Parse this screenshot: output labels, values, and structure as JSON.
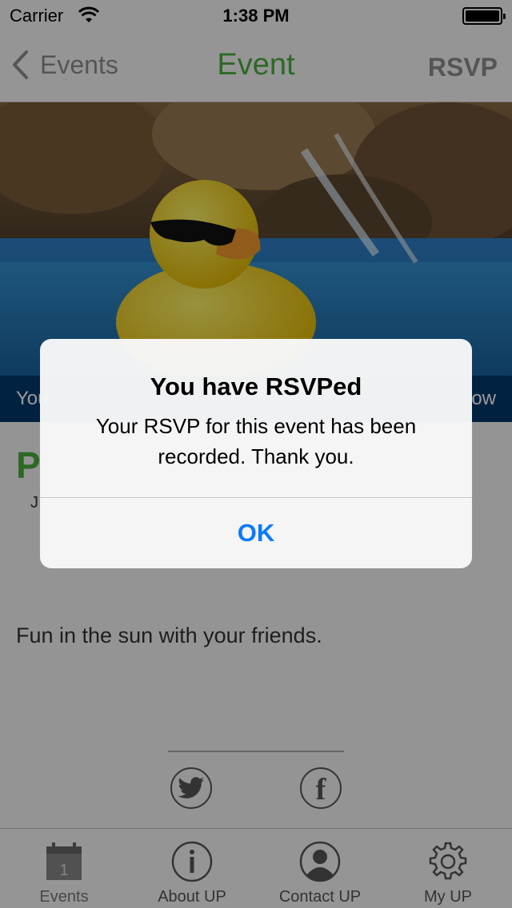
{
  "status_bar": {
    "carrier": "Carrier",
    "time": "1:38 PM"
  },
  "nav": {
    "back_label": "Events",
    "title": "Event",
    "rsvp_label": "RSVP"
  },
  "hero": {
    "banner_left": "You",
    "banner_right": "ow"
  },
  "event": {
    "title_partial": "P",
    "date_partial": "J",
    "description": "Fun in the sun with your friends."
  },
  "share": {
    "icons": [
      "twitter-icon",
      "facebook-icon"
    ]
  },
  "tabs": [
    {
      "label": "Events",
      "icon": "calendar-icon",
      "calendar_day": "1"
    },
    {
      "label": "About UP",
      "icon": "info-icon"
    },
    {
      "label": "Contact UP",
      "icon": "person-icon"
    },
    {
      "label": "My UP",
      "icon": "gear-icon"
    }
  ],
  "alert": {
    "title": "You have RSVPed",
    "message": "Your RSVP for this event has been recorded. Thank you.",
    "ok_label": "OK"
  },
  "colors": {
    "accent_green": "#4cae3e",
    "ios_blue": "#0a7aff",
    "banner_blue": "#0a3a6a"
  }
}
